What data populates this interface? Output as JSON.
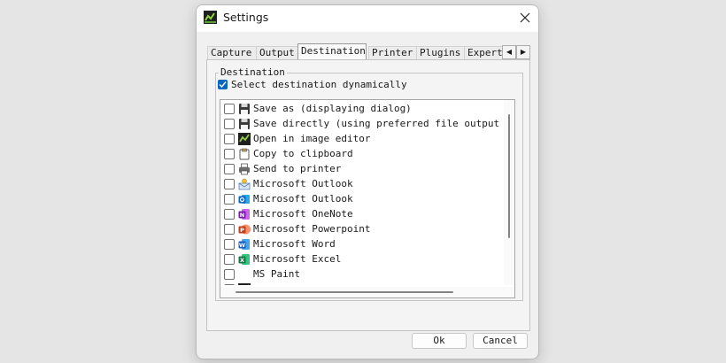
{
  "window": {
    "title": "Settings"
  },
  "tabs": [
    {
      "label": "Capture"
    },
    {
      "label": "Output"
    },
    {
      "label": "Destination"
    },
    {
      "label": "Printer"
    },
    {
      "label": "Plugins"
    },
    {
      "label": "Expert"
    }
  ],
  "destination": {
    "group_label": "Destination",
    "dynamic_label": "Select destination dynamically",
    "items": [
      {
        "label": "Save as (displaying dialog)",
        "icon": "floppy-icon"
      },
      {
        "label": "Save directly (using preferred file output setti",
        "icon": "floppy-icon"
      },
      {
        "label": "Open in image editor",
        "icon": "greenshot-icon"
      },
      {
        "label": "Copy to clipboard",
        "icon": "clipboard-icon"
      },
      {
        "label": "Send to printer",
        "icon": "printer-icon"
      },
      {
        "label": "Microsoft Outlook",
        "icon": "outlook-classic-icon"
      },
      {
        "label": "Microsoft Outlook",
        "icon": "outlook-icon"
      },
      {
        "label": "Microsoft OneNote",
        "icon": "onenote-icon"
      },
      {
        "label": "Microsoft Powerpoint",
        "icon": "powerpoint-icon"
      },
      {
        "label": "Microsoft Word",
        "icon": "word-icon"
      },
      {
        "label": "Microsoft Excel",
        "icon": "excel-icon"
      },
      {
        "label": "MS Paint",
        "icon": ""
      }
    ]
  },
  "buttons": {
    "ok": "Ok",
    "cancel": "Cancel"
  }
}
